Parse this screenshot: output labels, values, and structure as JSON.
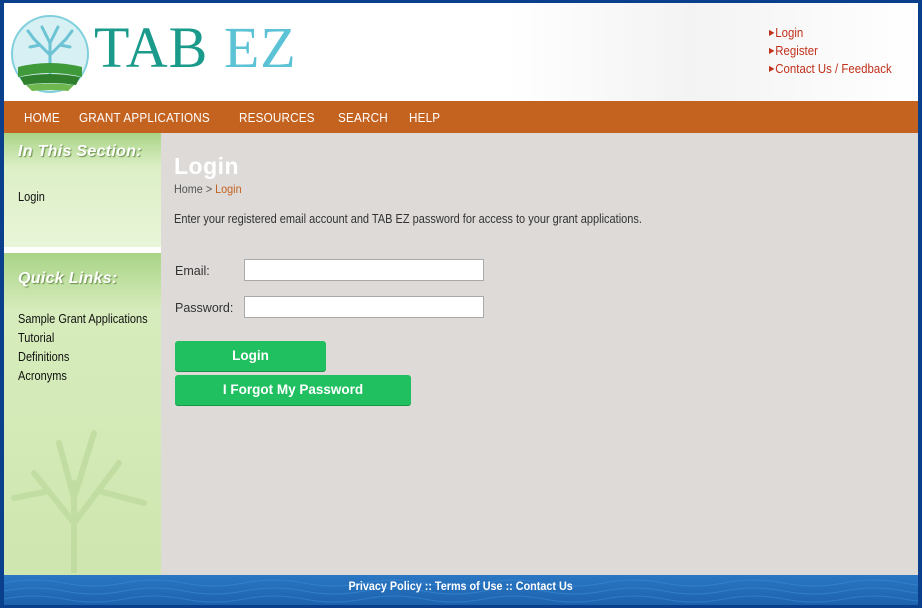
{
  "header": {
    "logo_part1": "TAB",
    "logo_part2": "EZ",
    "links": [
      "Login",
      "Register",
      "Contact Us / Feedback"
    ]
  },
  "nav": {
    "items": [
      "HOME",
      "GRANT APPLICATIONS",
      "RESOURCES",
      "SEARCH",
      "HELP"
    ]
  },
  "sidebar": {
    "section_heading": "In This Section:",
    "section_items": [
      "Login"
    ],
    "quick_heading": "Quick Links:",
    "quick_items": [
      "Sample Grant Applications",
      "Tutorial",
      "Definitions",
      "Acronyms"
    ]
  },
  "main": {
    "title": "Login",
    "breadcrumb_home": "Home",
    "breadcrumb_sep": ">",
    "breadcrumb_current": "Login",
    "intro": "Enter your registered email account and TAB EZ password for access to your grant applications.",
    "email_label": "Email:",
    "email_value": "",
    "password_label": "Password:",
    "password_value": "",
    "login_button": "Login",
    "forgot_button": "I Forgot My Password"
  },
  "footer": {
    "privacy": "Privacy Policy",
    "terms": "Terms of Use",
    "contact": "Contact Us",
    "sep": "::"
  },
  "colors": {
    "nav_bg": "#c4621f",
    "sidebar_green": "#c6e2a4",
    "main_bg": "#dddad8",
    "button_green": "#20c060",
    "footer_blue": "#1d62ad",
    "link_red": "#c0301a",
    "logo_teal": "#1a9a8a",
    "logo_blue": "#5cc2d6"
  }
}
